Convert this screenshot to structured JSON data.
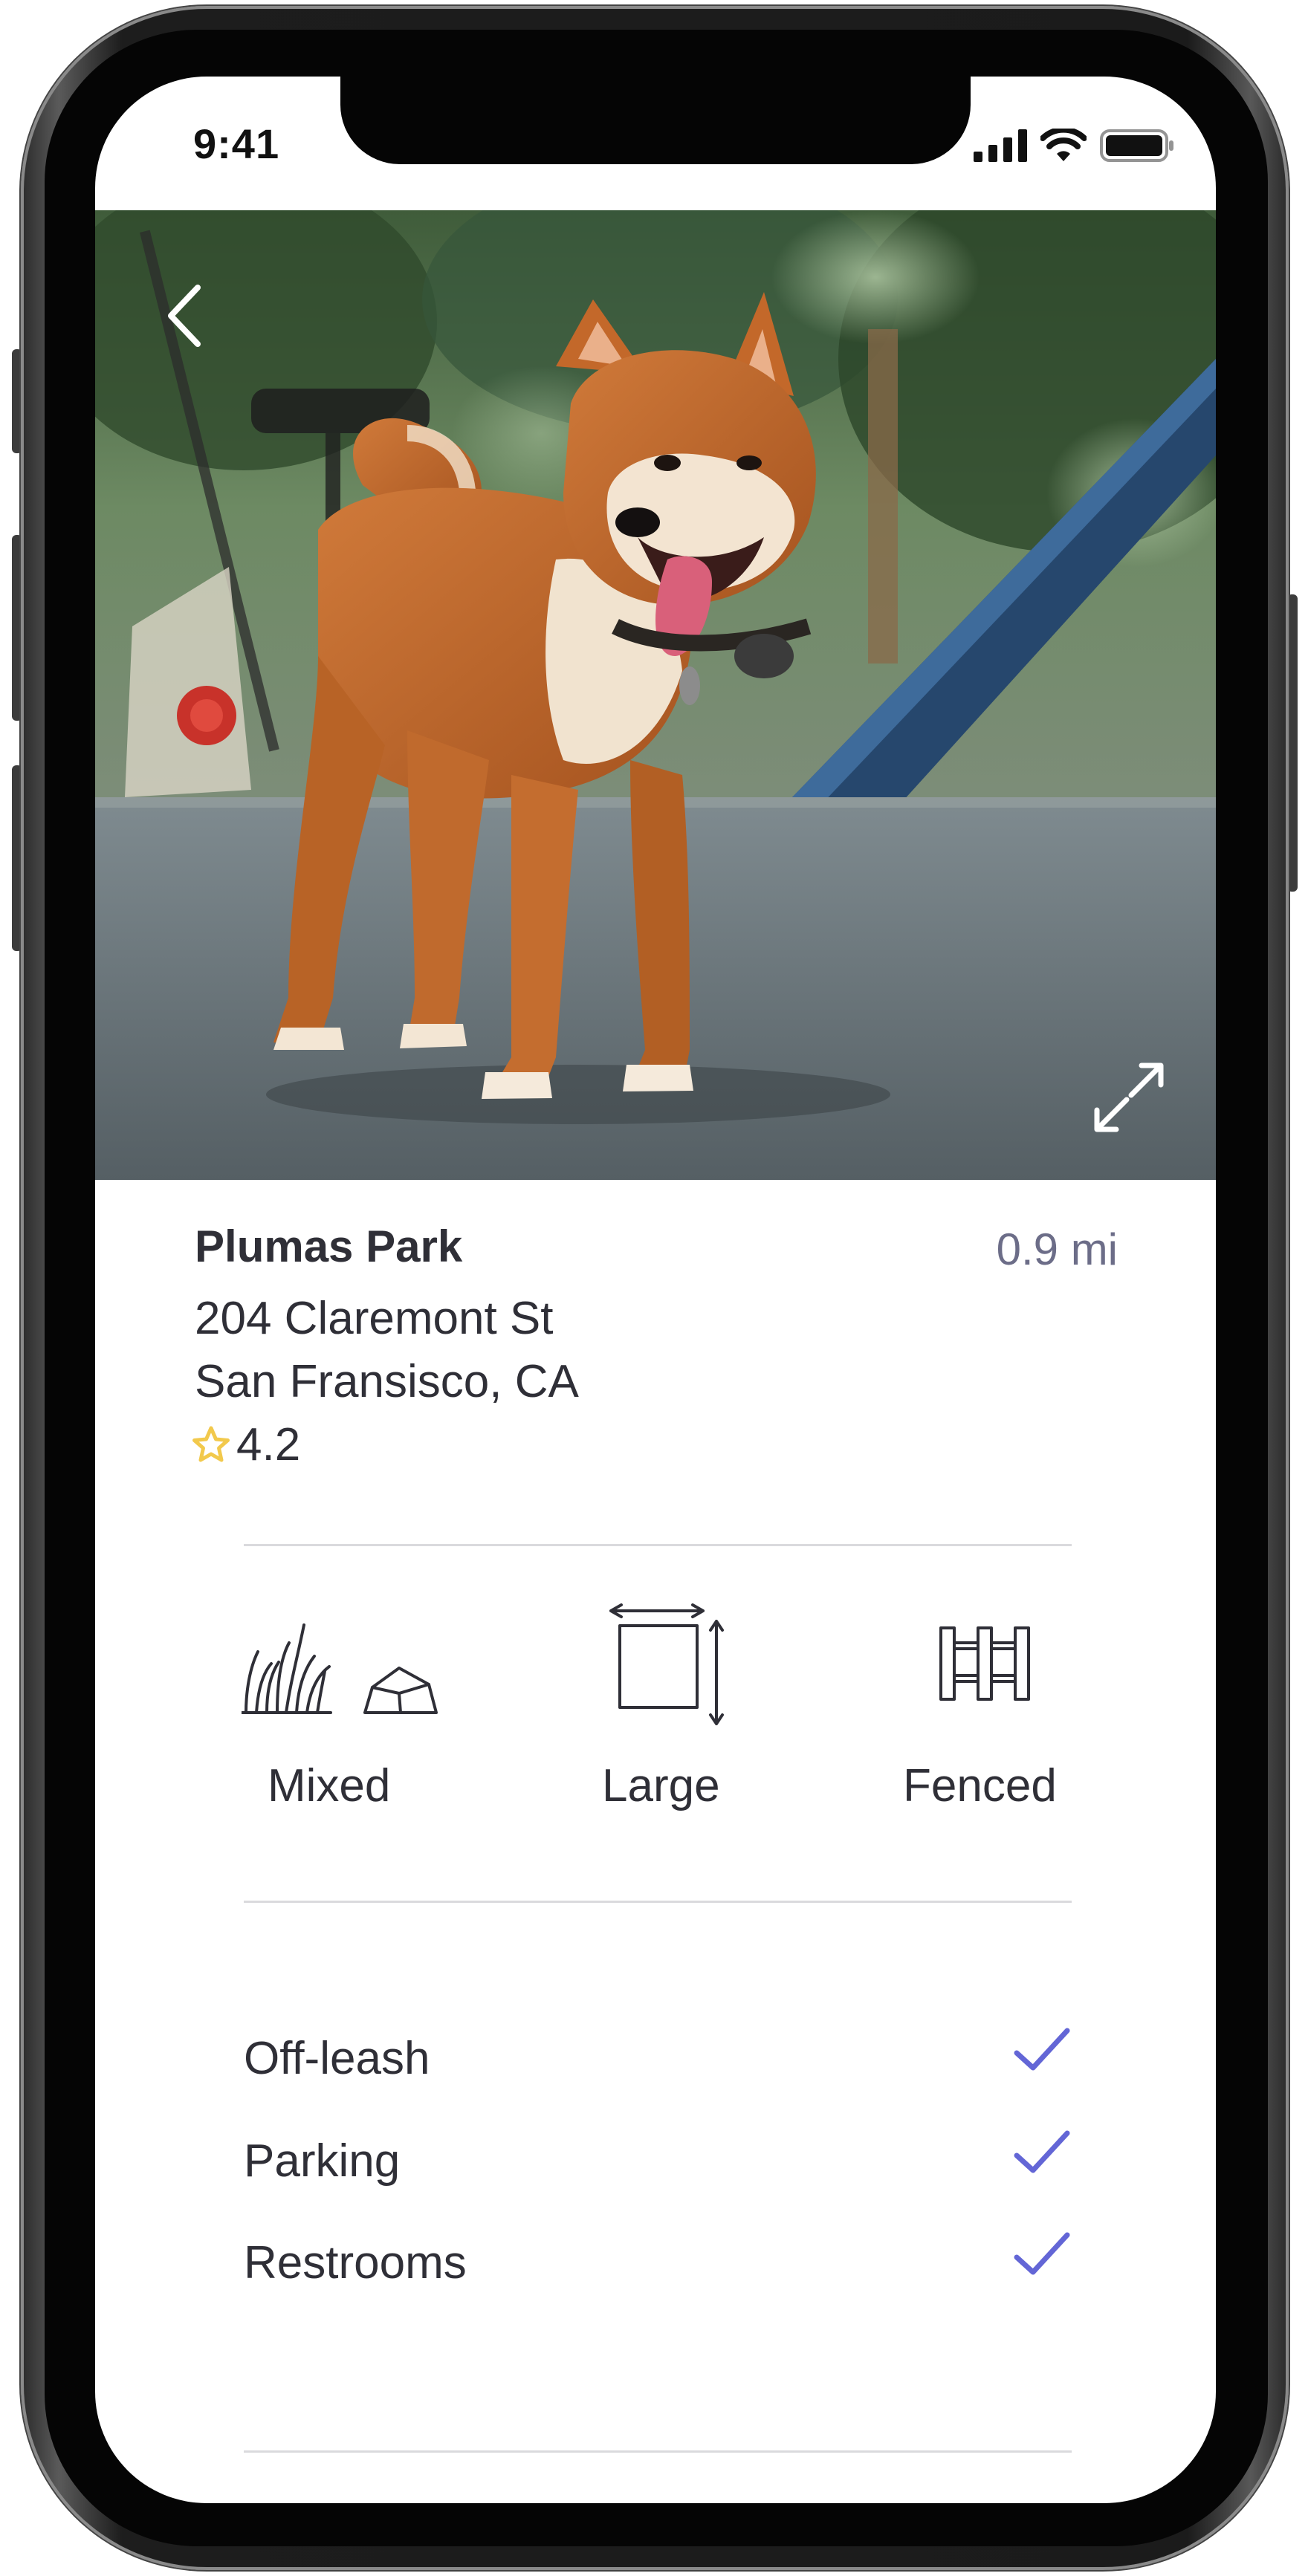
{
  "status_bar": {
    "time": "9:41"
  },
  "hero": {
    "photo_alt": "Shiba Inu dog standing in a park"
  },
  "park": {
    "name": "Plumas Park",
    "distance": "0.9 mi",
    "address_line1": "204 Claremont St",
    "address_line2": "San Fransisco, CA",
    "rating": "4.2"
  },
  "features": [
    {
      "label": "Mixed",
      "icon": "grass-rock-icon"
    },
    {
      "label": "Large",
      "icon": "size-area-icon"
    },
    {
      "label": "Fenced",
      "icon": "fence-icon"
    }
  ],
  "amenities": [
    {
      "label": "Off-leash",
      "checked": true
    },
    {
      "label": "Parking",
      "checked": true
    },
    {
      "label": "Restrooms",
      "checked": true
    }
  ],
  "colors": {
    "accent": "#6366d6",
    "star": "#f2c94c",
    "text": "#2f2f37",
    "secondary_text": "#6c6d88"
  }
}
